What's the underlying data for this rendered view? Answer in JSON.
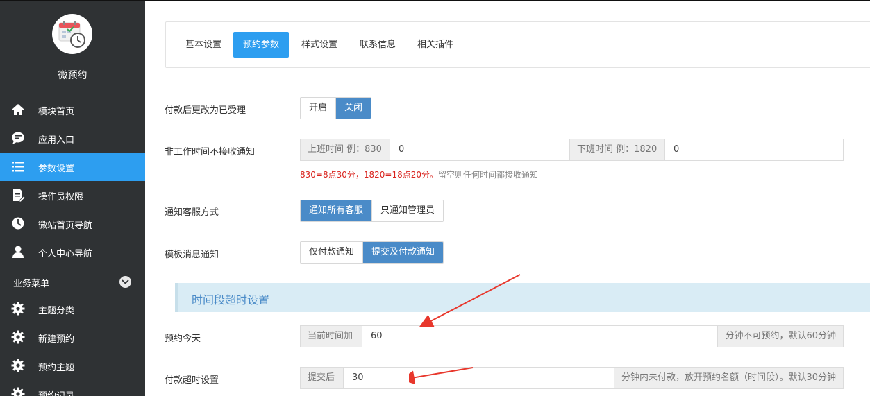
{
  "sidebar": {
    "app_name": "微预约",
    "items": [
      {
        "label": "模块首页",
        "icon": "home-icon"
      },
      {
        "label": "应用入口",
        "icon": "chat-bubble-icon"
      },
      {
        "label": "参数设置",
        "icon": "list-icon",
        "active": true
      },
      {
        "label": "操作员权限",
        "icon": "document-edit-icon"
      },
      {
        "label": "微站首页导航",
        "icon": "clock-icon"
      },
      {
        "label": "个人中心导航",
        "icon": "user-icon"
      }
    ],
    "section_title": "业务菜单",
    "business_items": [
      {
        "label": "主题分类",
        "icon": "gear-icon"
      },
      {
        "label": "新建预约",
        "icon": "gear-icon"
      },
      {
        "label": "预约主题",
        "icon": "gear-icon"
      },
      {
        "label": "预约记录",
        "icon": "gear-icon"
      }
    ]
  },
  "tabs": [
    "基本设置",
    "预约参数",
    "样式设置",
    "联系信息",
    "相关插件"
  ],
  "active_tab": "预约参数",
  "form": {
    "pay_accept": {
      "label": "付款后更改为已受理",
      "options": [
        "开启",
        "关闭"
      ],
      "selected": "关闭"
    },
    "off_hours": {
      "label": "非工作时间不接收通知",
      "start_addon": "上班时间 例：830",
      "start_value": "0",
      "end_addon": "下班时间 例：1820",
      "end_value": "0",
      "hint_red": "830=8点30分，1820=18点20分。",
      "hint_gray": "留空则任何时间都接收通知"
    },
    "notify_mode": {
      "label": "通知客服方式",
      "options": [
        "通知所有客服",
        "只通知管理员"
      ],
      "selected": "通知所有客服"
    },
    "template_msg": {
      "label": "模板消息通知",
      "options": [
        "仅付款通知",
        "提交及付款通知"
      ],
      "selected": "提交及付款通知"
    },
    "timeout_section": "时间段超时设置",
    "today": {
      "label": "预约今天",
      "prefix": "当前时间加",
      "value": "60",
      "suffix": "分钟不可预约，默认60分钟"
    },
    "pay_timeout": {
      "label": "付款超时设置",
      "prefix": "提交后",
      "value": "30",
      "suffix": "分钟内未付款，放开预约名额（时间段）。默认30分钟"
    }
  },
  "colors": {
    "accent": "#2d9ef0",
    "selected_button": "#4a8bc8",
    "sidebar_bg": "#2f3234",
    "hint_red": "#d9231d",
    "arrow": "#e8372c"
  }
}
